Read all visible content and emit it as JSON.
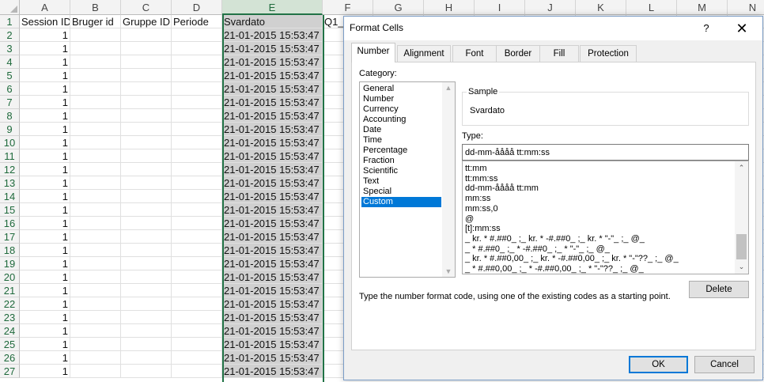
{
  "sheet": {
    "columns": [
      "A",
      "B",
      "C",
      "D",
      "E",
      "F",
      "G",
      "H",
      "I",
      "J",
      "K",
      "L",
      "M",
      "N"
    ],
    "headers": [
      "Session ID",
      "Bruger id",
      "Gruppe ID",
      "Periode",
      "Svardato",
      "Q1_"
    ],
    "rows": [
      "1",
      "2",
      "3",
      "4",
      "5",
      "6",
      "7",
      "8",
      "9",
      "10",
      "11",
      "12",
      "13",
      "14",
      "15",
      "16",
      "17",
      "18",
      "19",
      "20",
      "21",
      "22",
      "23",
      "24",
      "25",
      "26",
      "27"
    ],
    "session_value": "1",
    "date_value": "21-01-2015 15:53:47",
    "selected_column": "E"
  },
  "dialog": {
    "title": "Format Cells",
    "help": "?",
    "close": "✕",
    "tabs": [
      "Number",
      "Alignment",
      "Font",
      "Border",
      "Fill",
      "Protection"
    ],
    "active_tab": "Number",
    "category_label": "Category:",
    "categories": [
      "General",
      "Number",
      "Currency",
      "Accounting",
      "Date",
      "Time",
      "Percentage",
      "Fraction",
      "Scientific",
      "Text",
      "Special",
      "Custom"
    ],
    "selected_category": "Custom",
    "sample_label": "Sample",
    "sample_value": "Svardato",
    "type_label": "Type:",
    "type_value": "dd-mm-åååå tt:mm:ss",
    "type_list": [
      "tt:mm",
      "tt:mm:ss",
      "dd-mm-åååå tt:mm",
      "mm:ss",
      "mm:ss,0",
      "@",
      "[t]:mm:ss",
      "_ kr. * #.##0_ ;_ kr. * -#.##0_ ;_ kr. * \"-\"_ ;_ @_",
      "_ * #.##0_ ;_ * -#.##0_ ;_ * \"-\"_ ;_ @_",
      "_ kr. * #.##0,00_ ;_ kr. * -#.##0,00_ ;_ kr. * \"-\"??_ ;_ @_",
      "_ * #.##0,00_ ;_ * -#.##0,00_ ;_ * \"-\"??_ ;_ @_"
    ],
    "delete_label": "Delete",
    "hint": "Type the number format code, using one of the existing codes as a starting point.",
    "ok_label": "OK",
    "cancel_label": "Cancel",
    "accent_color": "#0078d7",
    "sheet_accent_color": "#217346"
  }
}
